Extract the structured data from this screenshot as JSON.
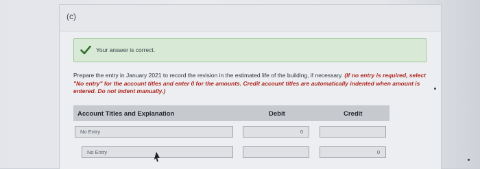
{
  "part_label": "(c)",
  "feedback": {
    "message": "Your answer is correct.",
    "icon": "checkmark-icon",
    "color": "#2f6e2a"
  },
  "instructions": {
    "main": "Prepare the entry in January 2021 to record the revision in the estimated life of the building, if necessary.",
    "note": "(If no entry is required, select \"No entry\" for the account titles and enter 0 for the amounts. Credit account titles are automatically indented when amount is entered. Do not indent manually.)"
  },
  "table": {
    "headers": {
      "account": "Account Titles and Explanation",
      "debit": "Debit",
      "credit": "Credit"
    },
    "rows": [
      {
        "account": "No Entry",
        "debit": "0",
        "credit": ""
      },
      {
        "account": "No Entry",
        "debit": "",
        "credit": "0"
      }
    ]
  }
}
